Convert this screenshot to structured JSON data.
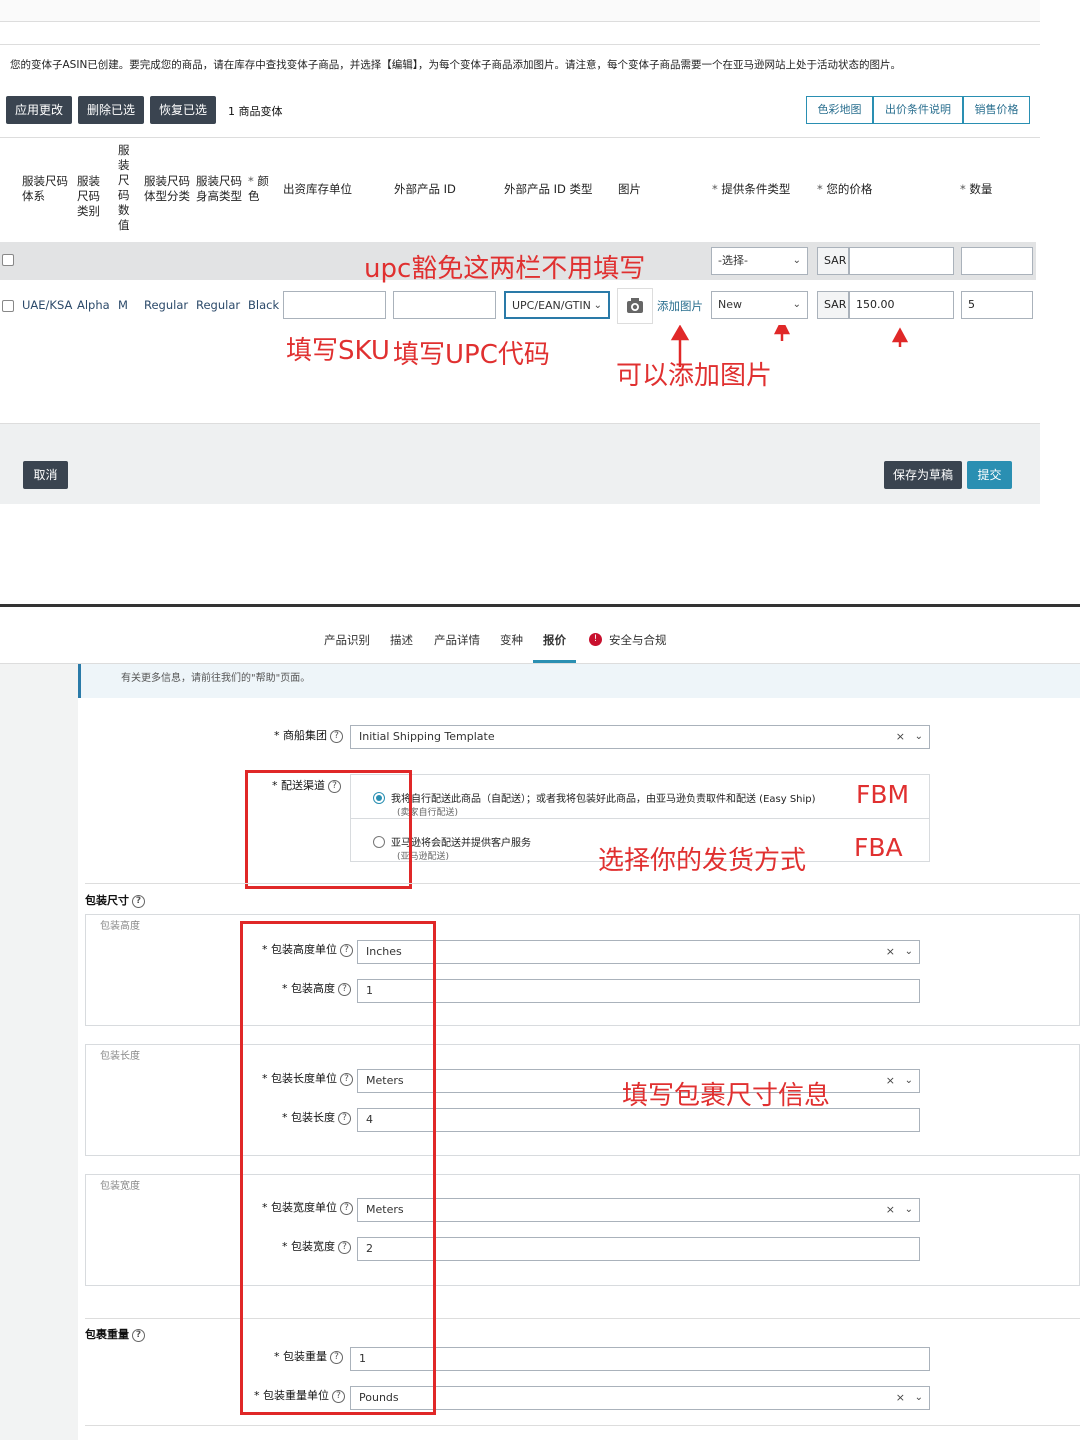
{
  "top": {
    "notice": "您的变体子ASIN已创建。要完成您的商品，请在库存中查找变体子商品，并选择【编辑】，为每个变体子商品添加图片。请注意，每个变体子商品需要一个在亚马逊网站上处于活动状态的图片。",
    "toolbar": {
      "apply": "应用更改",
      "delete": "删除已选",
      "restore": "恢复已选",
      "count": "1 商品变体"
    },
    "right_buttons": [
      "色彩地图",
      "出价条件说明",
      "销售价格"
    ],
    "headers": {
      "size_system": "服装尺码体系",
      "size_class": "服装尺码类别",
      "size_value": "服装尺码数值",
      "body_type": "服装尺码体型分类",
      "height_type": "服装尺码身高类型",
      "color_star": "*",
      "color": "颜色",
      "sku": "出资库存单位",
      "ext_id": "外部产品 ID",
      "ext_id_type": "外部产品 ID 类型",
      "image": "图片",
      "condition_star": "*",
      "condition": "提供条件类型",
      "price_star": "*",
      "price": "您的价格",
      "qty_star": "*",
      "qty": "数量"
    },
    "bulk_row": {
      "condition": "-选择-",
      "currency": "SAR"
    },
    "row": {
      "size_system": "UAE/KSA",
      "size_class": "Alpha",
      "size_value": "M",
      "body_type": "Regular",
      "height_type": "Regular",
      "color": "Black",
      "id_type": "UPC/EAN/GTIN",
      "add_image": "添加图片",
      "condition": "New",
      "currency": "SAR",
      "price": "150.00",
      "qty": "5"
    },
    "annotations": {
      "upc_exempt": "upc豁免这两栏不用填写",
      "fill_sku": "填写SKU",
      "fill_upc": "填写UPC代码",
      "add_image": "可以添加图片"
    },
    "cancel": "取消",
    "save_draft": "保存为草稿",
    "submit": "提交"
  },
  "bottom": {
    "tabs": [
      "产品识别",
      "描述",
      "产品详情",
      "变种",
      "报价",
      "安全与合规"
    ],
    "active_tab": "报价",
    "info": "有关更多信息，请前往我们的\"帮助\"页面。",
    "shipping_template_label": "商船集团",
    "shipping_template_value": "Initial Shipping Template",
    "channel_label": "配送渠道",
    "fbm_option": "我将自行配送此商品（自配送）；或者我将包装好此商品，由亚马逊负责取件和配送 (Easy Ship)",
    "fbm_sub": "(卖家自行配送)",
    "fba_option": "亚马逊将会配送并提供客户服务",
    "fba_sub": "(亚马逊配送)",
    "fbm_tag": "FBM",
    "fba_tag": "FBA",
    "choose_ship": "选择你的发货方式",
    "pkg_dim_title": "包装尺寸",
    "height_section": "包装高度",
    "height_unit_label": "包装高度单位",
    "height_unit": "Inches",
    "height_label": "包装高度",
    "height_value": "1",
    "length_section": "包装长度",
    "length_unit_label": "包装长度单位",
    "length_unit": "Meters",
    "length_label": "包装长度",
    "length_value": "4",
    "width_section": "包装宽度",
    "width_unit_label": "包装宽度单位",
    "width_unit": "Meters",
    "width_label": "包装宽度",
    "width_value": "2",
    "fill_pkg": "填写包裹尺寸信息",
    "weight_title": "包裹重量",
    "weight_label": "包装重量",
    "weight_value": "1",
    "weight_unit_label": "包装重量单位",
    "weight_unit": "Pounds",
    "star": "*",
    "clear": "×",
    "chevron": "⌄",
    "help": "?"
  },
  "colors": {
    "annotation": "#e02828",
    "accent": "#2a8fb2",
    "dark_button": "#3a4450"
  }
}
